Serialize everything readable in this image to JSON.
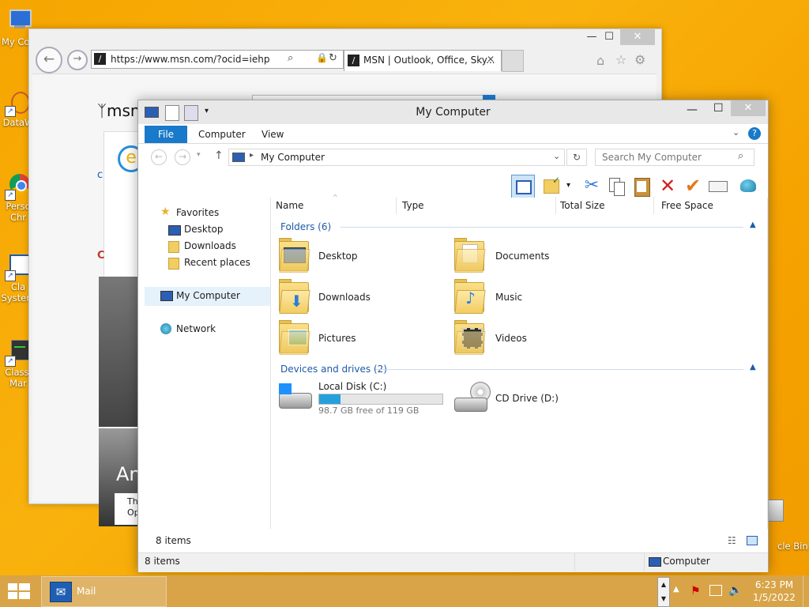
{
  "desktop": {
    "icons": [
      {
        "label": "My Co"
      },
      {
        "label": "DataW"
      },
      {
        "label": "Perso Chr"
      },
      {
        "label": "Cla System"
      },
      {
        "label": "Classi Mar"
      },
      {
        "label": "cle Bin"
      }
    ]
  },
  "ie": {
    "url": "https://www.msn.com/?ocid=iehp",
    "tab_title": "MSN | Outlook, Office, Sky...",
    "logo_text": "msn",
    "page_snippets": [
      "C",
      "An",
      "Th",
      "Op"
    ]
  },
  "explorer": {
    "title": "My Computer",
    "ribbon_tabs": {
      "file": "File",
      "computer": "Computer",
      "view": "View"
    },
    "breadcrumb": "My Computer",
    "search_placeholder": "Search My Computer",
    "nav": {
      "favorites": "Favorites",
      "desktop": "Desktop",
      "downloads": "Downloads",
      "recent": "Recent places",
      "my_computer": "My Computer",
      "network": "Network"
    },
    "columns": {
      "name": "Name",
      "type": "Type",
      "total_size": "Total Size",
      "free_space": "Free Space"
    },
    "folders_group": "Folders (6)",
    "folders": [
      "Desktop",
      "Documents",
      "Downloads",
      "Music",
      "Pictures",
      "Videos"
    ],
    "drives_group": "Devices and drives (2)",
    "local_disk": {
      "name": "Local Disk (C:)",
      "free_text": "98.7 GB free of 119 GB",
      "used_fraction": 0.17
    },
    "cd_drive": "CD Drive (D:)",
    "status_items": "8 items",
    "outer_status_items": "8 items",
    "outer_status_location": "Computer"
  },
  "taskbar": {
    "mail_label": "Mail",
    "time": "6:23 PM",
    "date": "1/5/2022"
  }
}
